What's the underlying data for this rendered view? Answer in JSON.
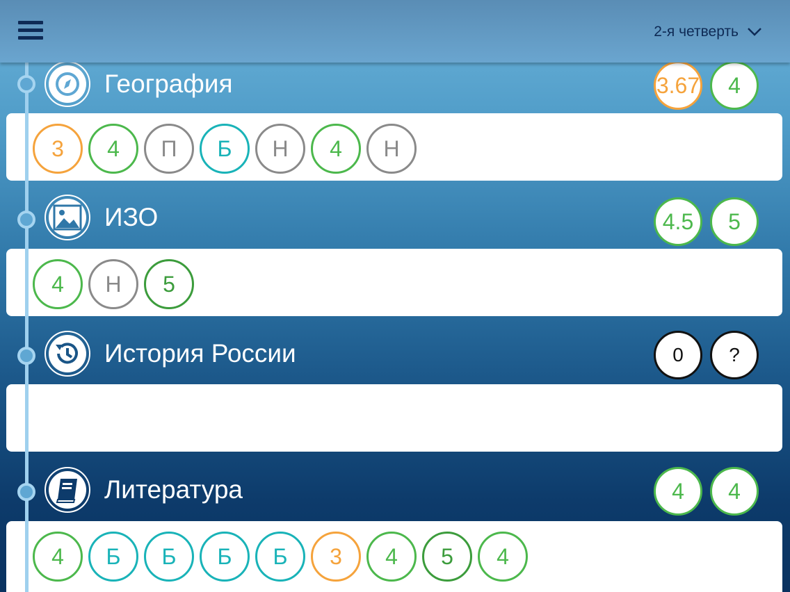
{
  "header": {
    "period_label": "2-я четверть"
  },
  "colors": {
    "green": "#4cb84c",
    "dark_green": "#3c9c3c",
    "orange": "#f5a33c",
    "teal": "#19b3b8",
    "gray": "#8a8a8a",
    "black": "#111111"
  },
  "subjects": [
    {
      "title": "География",
      "icon": "compass-icon",
      "avg_label": "3.67",
      "final_label": "4",
      "grades": [
        "3",
        "4",
        "П",
        "Б",
        "Н",
        "4",
        "Н"
      ]
    },
    {
      "title": "ИЗО",
      "icon": "picture-icon",
      "avg_label": "4.5",
      "final_label": "5",
      "grades": [
        "4",
        "Н",
        "5"
      ]
    },
    {
      "title": "История России",
      "icon": "history-icon",
      "avg_label": "0",
      "final_label": "?",
      "grades": []
    },
    {
      "title": "Литература",
      "icon": "book-icon",
      "avg_label": "4",
      "final_label": "4",
      "grades": [
        "4",
        "Б",
        "Б",
        "Б",
        "Б",
        "3",
        "4",
        "5",
        "4"
      ]
    }
  ]
}
